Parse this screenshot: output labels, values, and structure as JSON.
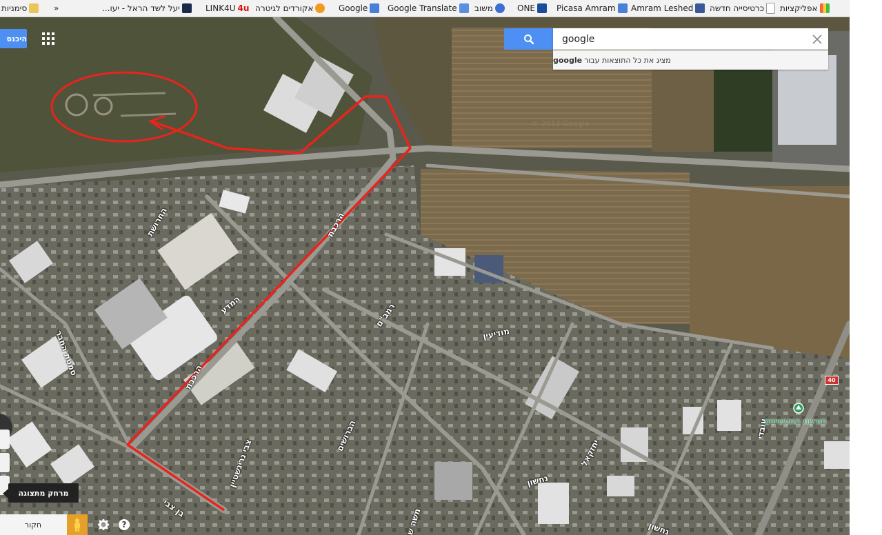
{
  "bookmarks_bar": {
    "items": [
      {
        "label": "אפליקציות",
        "icon": "apps-grid-icon"
      },
      {
        "label": "כרטיסייה חדשה",
        "icon": "page-icon"
      },
      {
        "label": "Amram Leshed",
        "icon": "facebook-icon"
      },
      {
        "label": "Picasa Amram",
        "icon": "google-icon"
      },
      {
        "label": "ONE",
        "icon": "one-icon"
      },
      {
        "label": "משוב",
        "icon": "feedback-icon"
      },
      {
        "label": "Google Translate",
        "icon": "translate-icon"
      },
      {
        "label": "Google",
        "icon": "google-icon"
      },
      {
        "label": "אקורדים לגיטרה",
        "icon": "guitar-icon"
      },
      {
        "label": "LINK4U",
        "icon": "4u-icon",
        "badge": "4u"
      },
      {
        "label": "יעל לשד הראל - יעו...",
        "icon": "site-icon"
      }
    ],
    "more": "»",
    "other_bookmarks": "סימניות"
  },
  "search": {
    "value": "google",
    "suggestion_prefix": "מציג את כל התוצאות עבור",
    "suggestion_term": "google"
  },
  "header": {
    "signin_label": "היכנס"
  },
  "map": {
    "watermark": "© 2013 Google",
    "road_labels": [
      "הרכבת",
      "הרכבת",
      "החרושת",
      "סמטת החבר",
      "המדע",
      "רמב\"ם",
      "מודיעין",
      "יחזקאל",
      "נחשון",
      "נחשון",
      "הברושים",
      "צבי גרינשטיין",
      "בן צבי",
      "משה שרת",
      "יחזקאל",
      "עובדי"
    ],
    "poi": "חורשת התעשיינים",
    "route_number": "40"
  },
  "controls": {
    "distance_tooltip": "מרחק מתצוגה",
    "explore_label": "חקור",
    "help_label": "?"
  },
  "colors": {
    "route": "#e8241d",
    "search_blue": "#4d8ff3",
    "poi_green": "#2f9a5a"
  }
}
